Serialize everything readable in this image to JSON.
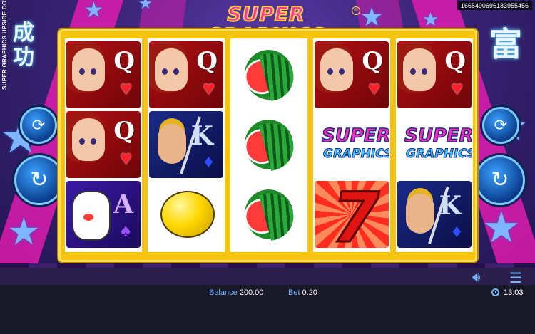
{
  "game": {
    "title": "SUPER GRAPHICS",
    "subtitle": "upside-down",
    "registered": "®",
    "side_title": "SUPER GRAPHICS UPSIDE DOWN",
    "game_id": "1665490696183955456",
    "glyph_left": "成功",
    "glyph_right": "富"
  },
  "reels": [
    [
      {
        "symbol": "queen-hearts",
        "letter": "Q",
        "suit": "♥"
      },
      {
        "symbol": "queen-hearts",
        "letter": "Q",
        "suit": "♥"
      },
      {
        "symbol": "ace-spades",
        "letter": "A",
        "suit": "♠"
      }
    ],
    [
      {
        "symbol": "queen-hearts",
        "letter": "Q",
        "suit": "♥"
      },
      {
        "symbol": "king-diamonds",
        "letter": "K",
        "suit": "♦"
      },
      {
        "symbol": "lemon"
      }
    ],
    [
      {
        "symbol": "watermelon"
      },
      {
        "symbol": "watermelon"
      },
      {
        "symbol": "watermelon"
      }
    ],
    [
      {
        "symbol": "queen-hearts",
        "letter": "Q",
        "suit": "♥"
      },
      {
        "symbol": "super-graphics-logo",
        "line1": "SUPER",
        "line2": "GRAPHICS"
      },
      {
        "symbol": "seven",
        "letter": "7"
      }
    ],
    [
      {
        "symbol": "queen-hearts",
        "letter": "Q",
        "suit": "♥"
      },
      {
        "symbol": "super-graphics-logo",
        "line1": "SUPER",
        "line2": "GRAPHICS"
      },
      {
        "symbol": "king-diamonds",
        "letter": "K",
        "suit": "♦"
      }
    ]
  ],
  "status_bar": {
    "balance_label": "Balance",
    "balance_value": "200.00",
    "bet_label": "Bet",
    "bet_value": "0.20",
    "time": "13:03"
  },
  "icons": {
    "sound": "speaker-icon",
    "menu": "hamburger-menu-icon",
    "clock": "clock-icon",
    "autoplay": "autoplay-icon",
    "spin": "spin-icon"
  },
  "colors": {
    "frame": "#f6c40e",
    "accent_pink": "#ff2fb8",
    "status_label": "#6eb7ff",
    "bar_bg": "#181827"
  }
}
